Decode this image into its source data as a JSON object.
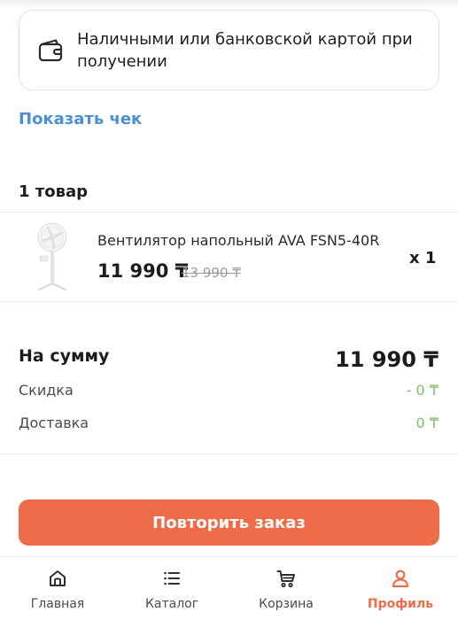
{
  "payment": {
    "icon": "wallet-icon",
    "text": "Наличными или банковской картой при получении"
  },
  "receipt_link": "Показать чек",
  "order": {
    "items_count": "1 товар",
    "items": [
      {
        "thumb": "standing-fan-image",
        "name": "Вентилятор напольный AVA FSN5-40R",
        "price": "11 990 ₸",
        "old_price": "13 990 ₸",
        "qty": "x 1"
      }
    ]
  },
  "summary": {
    "total_label": "На сумму",
    "total_value": "11 990 ₸",
    "discount_label": "Скидка",
    "discount_value": "- 0 ₸",
    "delivery_label": "Доставка",
    "delivery_value": "0 ₸"
  },
  "repeat_button": "Повторить заказ",
  "nav": {
    "items": [
      {
        "label": "Главная",
        "icon": "home-icon"
      },
      {
        "label": "Каталог",
        "icon": "list-icon"
      },
      {
        "label": "Корзина",
        "icon": "cart-icon"
      },
      {
        "label": "Профиль",
        "icon": "user-icon",
        "active": true
      }
    ]
  },
  "colors": {
    "accent": "#ef6c48",
    "link": "#4a8fd6",
    "discount_green": "#7cc06a"
  }
}
